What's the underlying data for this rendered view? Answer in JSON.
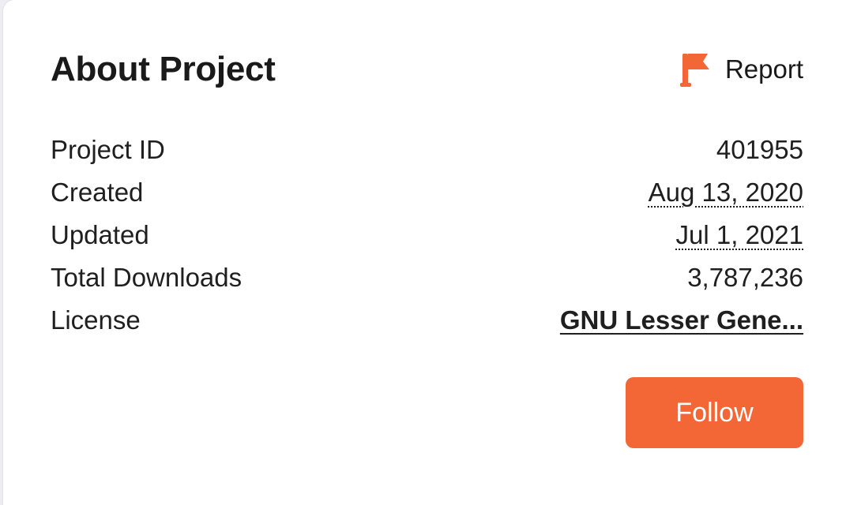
{
  "header": {
    "title": "About Project",
    "report_label": "Report"
  },
  "details": [
    {
      "label": "Project ID",
      "value": "401955"
    },
    {
      "label": "Created",
      "value": "Aug 13, 2020"
    },
    {
      "label": "Updated",
      "value": "Jul 1, 2021"
    },
    {
      "label": "Total Downloads",
      "value": "3,787,236"
    },
    {
      "label": "License",
      "value": "GNU Lesser Gene..."
    }
  ],
  "actions": {
    "follow_label": "Follow"
  },
  "colors": {
    "accent": "#f26735",
    "text": "#1a1a1a",
    "background": "#ffffff"
  },
  "icons": {
    "report": "flag-icon"
  }
}
